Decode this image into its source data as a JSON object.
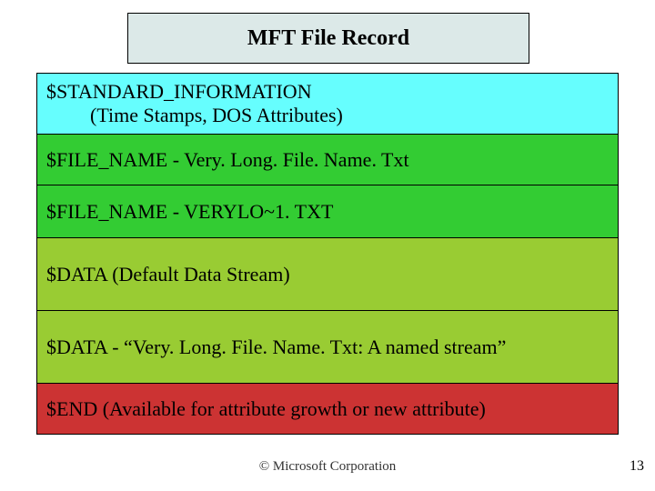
{
  "title": "MFT File Record",
  "rows": {
    "std_line1": "$STANDARD_INFORMATION",
    "std_line2": "(Time Stamps, DOS Attributes)",
    "fn_long": "$FILE_NAME - Very. Long. File. Name. Txt",
    "fn_short": "$FILE_NAME - VERYLO~1. TXT",
    "data_def": "$DATA (Default Data Stream)",
    "data_named": "$DATA - “Very. Long. File. Name. Txt: A named stream”",
    "end": "$END (Available for attribute growth or new attribute)"
  },
  "footer": {
    "copyright": "© Microsoft Corporation",
    "page": "13"
  }
}
